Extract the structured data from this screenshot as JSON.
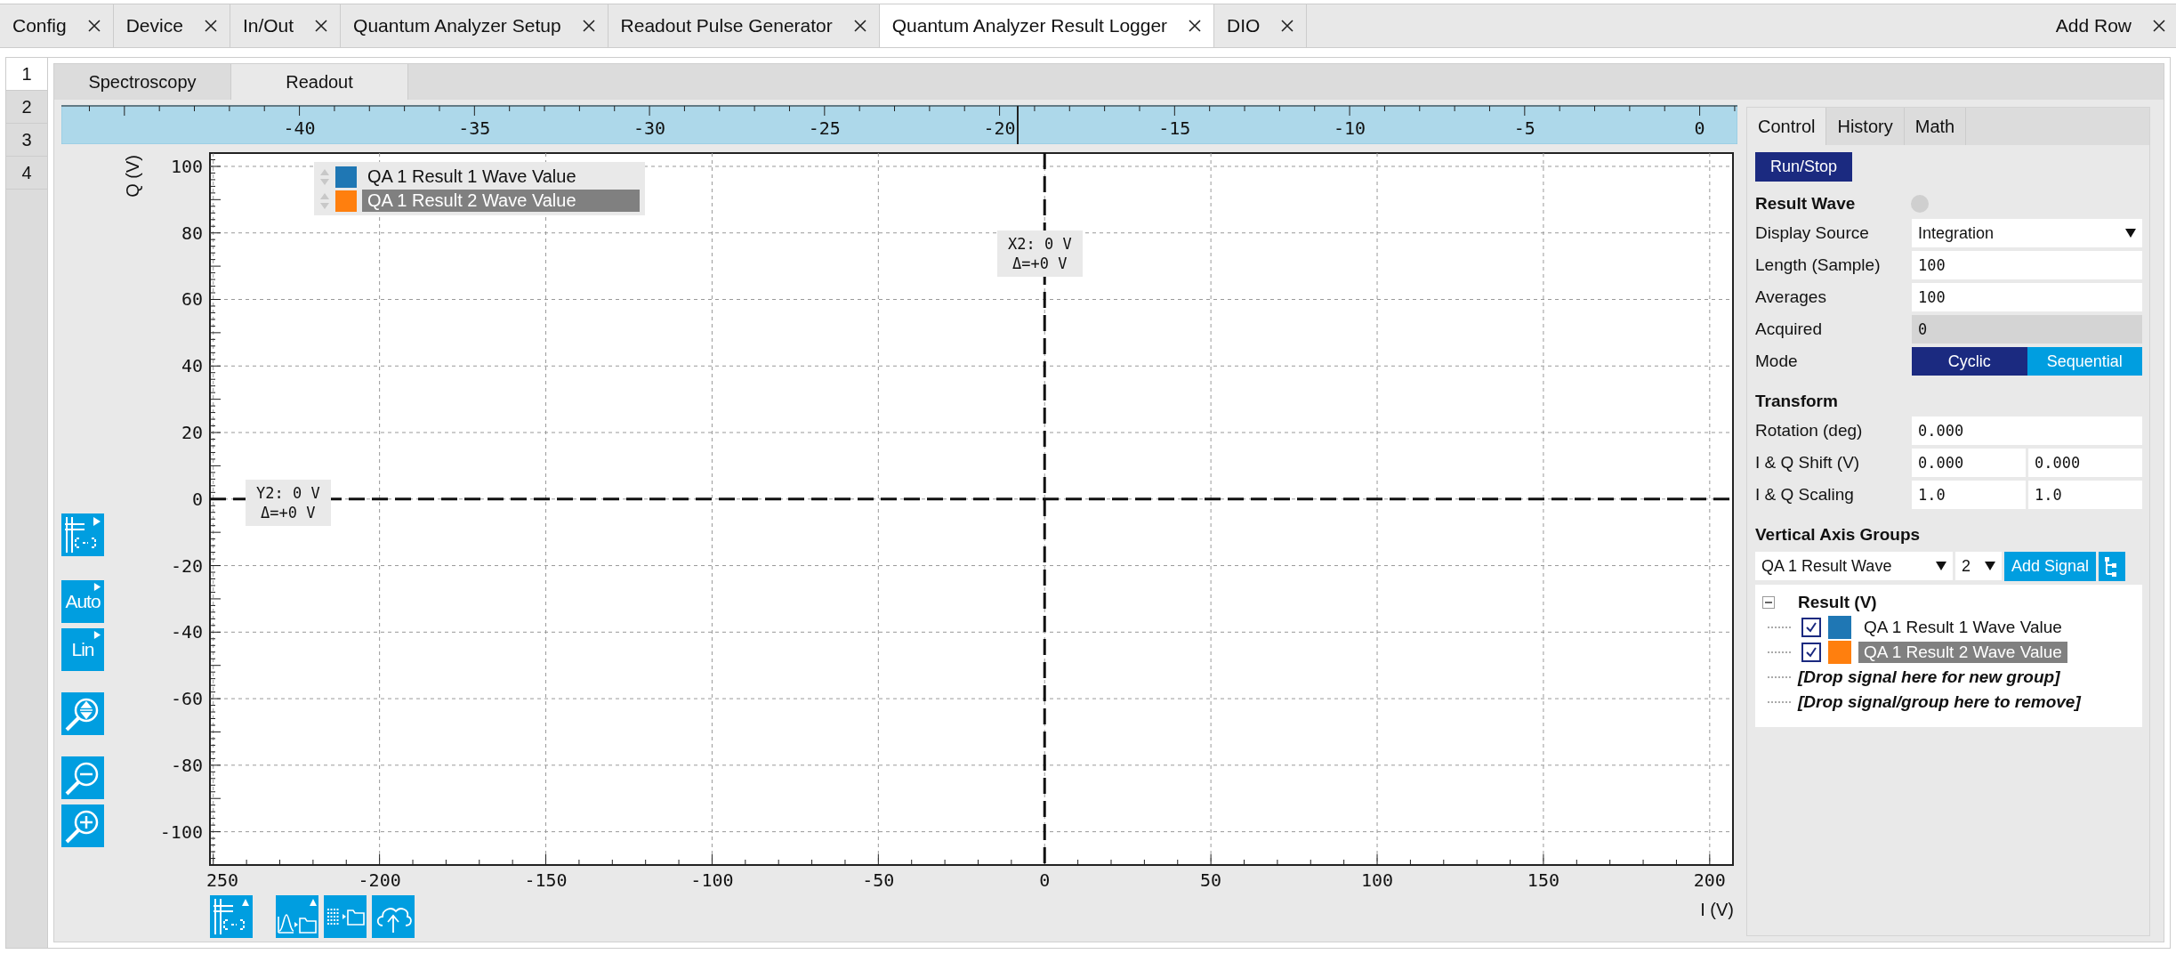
{
  "tabs": [
    {
      "label": "Config",
      "selected": false
    },
    {
      "label": "Device",
      "selected": false
    },
    {
      "label": "In/Out",
      "selected": false
    },
    {
      "label": "Quantum Analyzer Setup",
      "selected": false
    },
    {
      "label": "Readout Pulse Generator",
      "selected": false
    },
    {
      "label": "Quantum Analyzer Result Logger",
      "selected": true
    },
    {
      "label": "DIO",
      "selected": false
    }
  ],
  "add_row": "Add Row",
  "row_tabs": [
    {
      "label": "1",
      "selected": true
    },
    {
      "label": "2",
      "selected": false
    },
    {
      "label": "3",
      "selected": false
    },
    {
      "label": "4",
      "selected": false
    }
  ],
  "sub_tabs": [
    {
      "label": "Spectroscopy",
      "selected": false
    },
    {
      "label": "Readout",
      "selected": true
    }
  ],
  "plot": {
    "y_label": "Q (V)",
    "x_label": "I (V)",
    "y_ticks": [
      "100",
      "80",
      "60",
      "40",
      "20",
      "0",
      "-20",
      "-40",
      "-60",
      "-80",
      "-100"
    ],
    "x_ticks": [
      "250",
      "-200",
      "-150",
      "-100",
      "-50",
      "0",
      "50",
      "100",
      "150",
      "200"
    ],
    "ruler_ticks": [
      "-40",
      "-35",
      "-30",
      "-25",
      "-20",
      "-15",
      "-10",
      "-5",
      "0"
    ],
    "legend": [
      {
        "label": "QA 1 Result 1 Wave Value",
        "color": "#1f77b4",
        "selected": false
      },
      {
        "label": "QA 1 Result 2 Wave Value",
        "color": "#ff7f0e",
        "selected": true
      }
    ],
    "cursors": [
      {
        "kind": "x",
        "name": "X2: 0 V",
        "delta": "Δ=+0 V"
      },
      {
        "kind": "y",
        "name": "Y2: 0 V",
        "delta": "Δ=+0 V"
      }
    ]
  },
  "left_tools": [
    {
      "kind": "cursor"
    },
    {
      "kind": "text",
      "label": "Auto"
    },
    {
      "kind": "text",
      "label": "Lin"
    },
    {
      "kind": "zoom-fit"
    },
    {
      "kind": "zoom-out"
    },
    {
      "kind": "zoom-in"
    }
  ],
  "bottom_tools": [
    {
      "kind": "cursor"
    },
    {
      "kind": "save-plot"
    },
    {
      "kind": "save-table"
    },
    {
      "kind": "upload"
    }
  ],
  "panel": {
    "tabs": [
      {
        "label": "Control",
        "selected": true
      },
      {
        "label": "History",
        "selected": false
      },
      {
        "label": "Math",
        "selected": false
      }
    ],
    "run_button": "Run/Stop",
    "result_wave": {
      "title": "Result Wave",
      "fields": [
        {
          "kind": "select",
          "label": "Display Source",
          "value": "Integration"
        },
        {
          "kind": "input",
          "label": "Length (Sample)",
          "value": "100"
        },
        {
          "kind": "input",
          "label": "Averages",
          "value": "100"
        },
        {
          "kind": "readonly",
          "label": "Acquired",
          "value": "0"
        },
        {
          "kind": "segmented",
          "label": "Mode",
          "options": [
            {
              "label": "Cyclic",
              "selected": true
            },
            {
              "label": "Sequential",
              "selected": false
            }
          ]
        }
      ]
    },
    "transform": {
      "title": "Transform",
      "fields": [
        {
          "label": "Rotation (deg)",
          "values": [
            "0.000"
          ]
        },
        {
          "label": "I & Q Shift (V)",
          "values": [
            "0.000",
            "0.000"
          ]
        },
        {
          "label": "I & Q Scaling",
          "values": [
            "1.0",
            "1.0"
          ]
        }
      ]
    },
    "axis_groups": {
      "title": "Vertical Axis Groups",
      "signal_select": "QA 1 Result Wave",
      "count_select": "2",
      "add_button": "Add Signal",
      "tree": [
        {
          "label": "Result (V)",
          "expanded": true,
          "children": [
            {
              "label": "QA 1 Result 1 Wave Value",
              "checked": true,
              "color": "#1f77b4",
              "selected": false
            },
            {
              "label": "QA 1 Result 2 Wave Value",
              "checked": true,
              "color": "#ff7f0e",
              "selected": true
            }
          ]
        }
      ],
      "drop_hints": [
        "[Drop signal here for new group]",
        "[Drop signal/group here to remove]"
      ]
    }
  }
}
